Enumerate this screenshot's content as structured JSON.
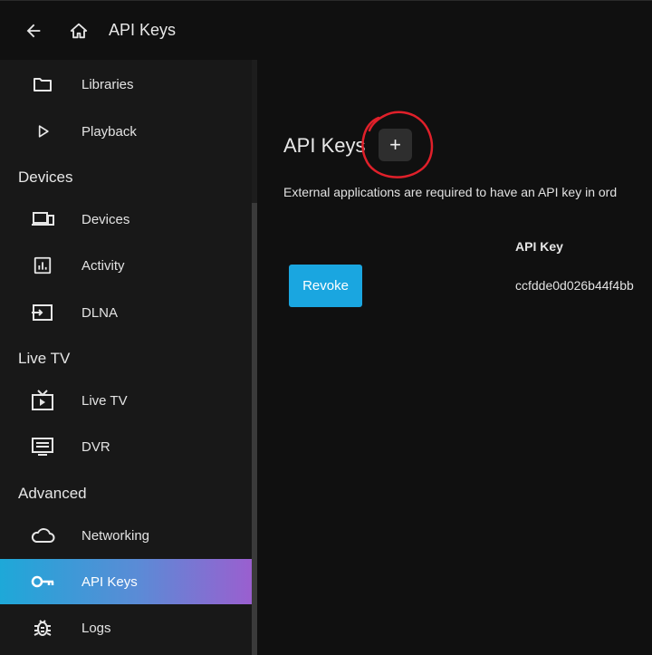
{
  "header": {
    "title": "API Keys",
    "back_icon": "arrow-left-icon",
    "home_icon": "home-icon"
  },
  "sidebar": {
    "items_top": [
      {
        "label": "Libraries",
        "icon": "folder-icon"
      },
      {
        "label": "Playback",
        "icon": "play-icon"
      }
    ],
    "sections": [
      {
        "title": "Devices",
        "items": [
          {
            "label": "Devices",
            "icon": "devices-icon"
          },
          {
            "label": "Activity",
            "icon": "activity-chart-icon"
          },
          {
            "label": "DLNA",
            "icon": "input-icon"
          }
        ]
      },
      {
        "title": "Live TV",
        "items": [
          {
            "label": "Live TV",
            "icon": "live-tv-icon"
          },
          {
            "label": "DVR",
            "icon": "dvr-icon"
          }
        ]
      },
      {
        "title": "Advanced",
        "items": [
          {
            "label": "Networking",
            "icon": "cloud-icon"
          },
          {
            "label": "API Keys",
            "icon": "key-icon",
            "active": true
          },
          {
            "label": "Logs",
            "icon": "bug-icon"
          }
        ]
      }
    ],
    "active_gradient": [
      "#1ea8d8",
      "#9a5fcf"
    ]
  },
  "main": {
    "title": "API Keys",
    "add_button_label": "+",
    "description": "External applications are required to have an API key in ord",
    "table": {
      "columns": [
        "",
        "API Key"
      ],
      "rows": [
        {
          "action": "Revoke",
          "api_key": "ccfdde0d026b44f4bb"
        }
      ]
    }
  },
  "colors": {
    "accent": "#1aa6e0",
    "background": "#101010",
    "sidebar": "#181818",
    "annotation": "#e0202a"
  }
}
